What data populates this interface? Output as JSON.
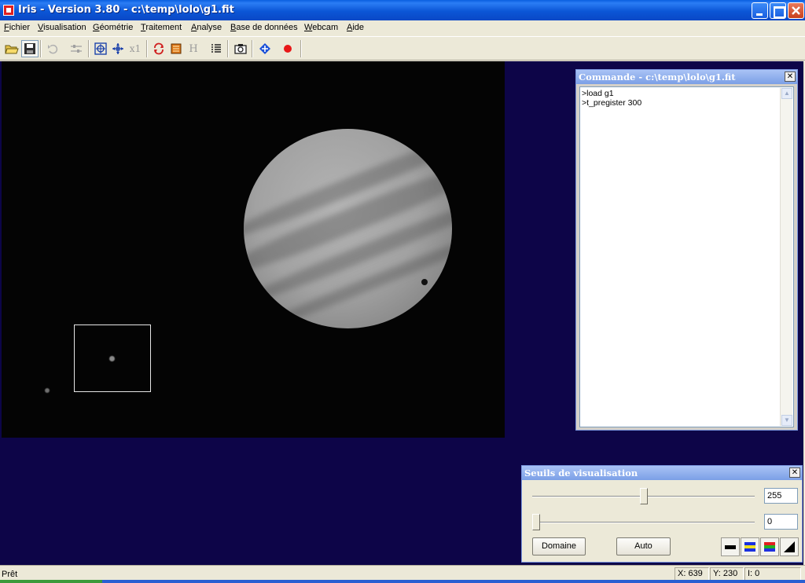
{
  "window": {
    "title": "Iris - Version 3.80 - c:\\temp\\lolo\\g1.fit",
    "app_icon": "iris-app-icon",
    "controls": [
      "minimize",
      "maximize",
      "close"
    ]
  },
  "menu": {
    "items": [
      {
        "label": "Fichier"
      },
      {
        "label": "Visualisation"
      },
      {
        "label": "Géométrie"
      },
      {
        "label": "Traitement"
      },
      {
        "label": "Analyse"
      },
      {
        "label": "Base de données"
      },
      {
        "label": "Webcam"
      },
      {
        "label": "Aide"
      }
    ]
  },
  "toolbar": {
    "buttons": [
      {
        "icon": "open-folder-icon"
      },
      {
        "icon": "save-icon"
      },
      {
        "icon": "undo-icon"
      },
      {
        "icon": "adjust-icon"
      },
      {
        "icon": "zoom-fit-icon"
      },
      {
        "icon": "move-icon"
      },
      {
        "icon": "zoom-x1-icon",
        "label": "x1"
      },
      {
        "icon": "swap-icon"
      },
      {
        "icon": "image-icon"
      },
      {
        "icon": "histogram-icon",
        "label": "H"
      },
      {
        "icon": "list-icon"
      },
      {
        "icon": "camera-icon"
      },
      {
        "icon": "crosshair-icon"
      },
      {
        "icon": "record-icon"
      }
    ]
  },
  "command_window": {
    "title": "Commande - c:\\temp\\lolo\\g1.fit",
    "lines": [
      ">load g1",
      ">t_pregister 300"
    ]
  },
  "thresholds_window": {
    "title": "Seuils de visualisation",
    "high_value": "255",
    "low_value": "0",
    "high_slider_fraction": 0.5,
    "low_slider_fraction": 0.0,
    "domain_button": "Domaine",
    "auto_button": "Auto",
    "palette_buttons": [
      "grayscale-palette-icon",
      "color-palette-icon",
      "rgb-palette-icon",
      "inverse-palette-icon"
    ]
  },
  "status": {
    "text": "Prêt",
    "x": "X: 639",
    "y": "Y: 230",
    "i": "I: 0"
  },
  "colors": {
    "workspace_bg": "#0d0548",
    "titlebar": "#0b56d6"
  }
}
